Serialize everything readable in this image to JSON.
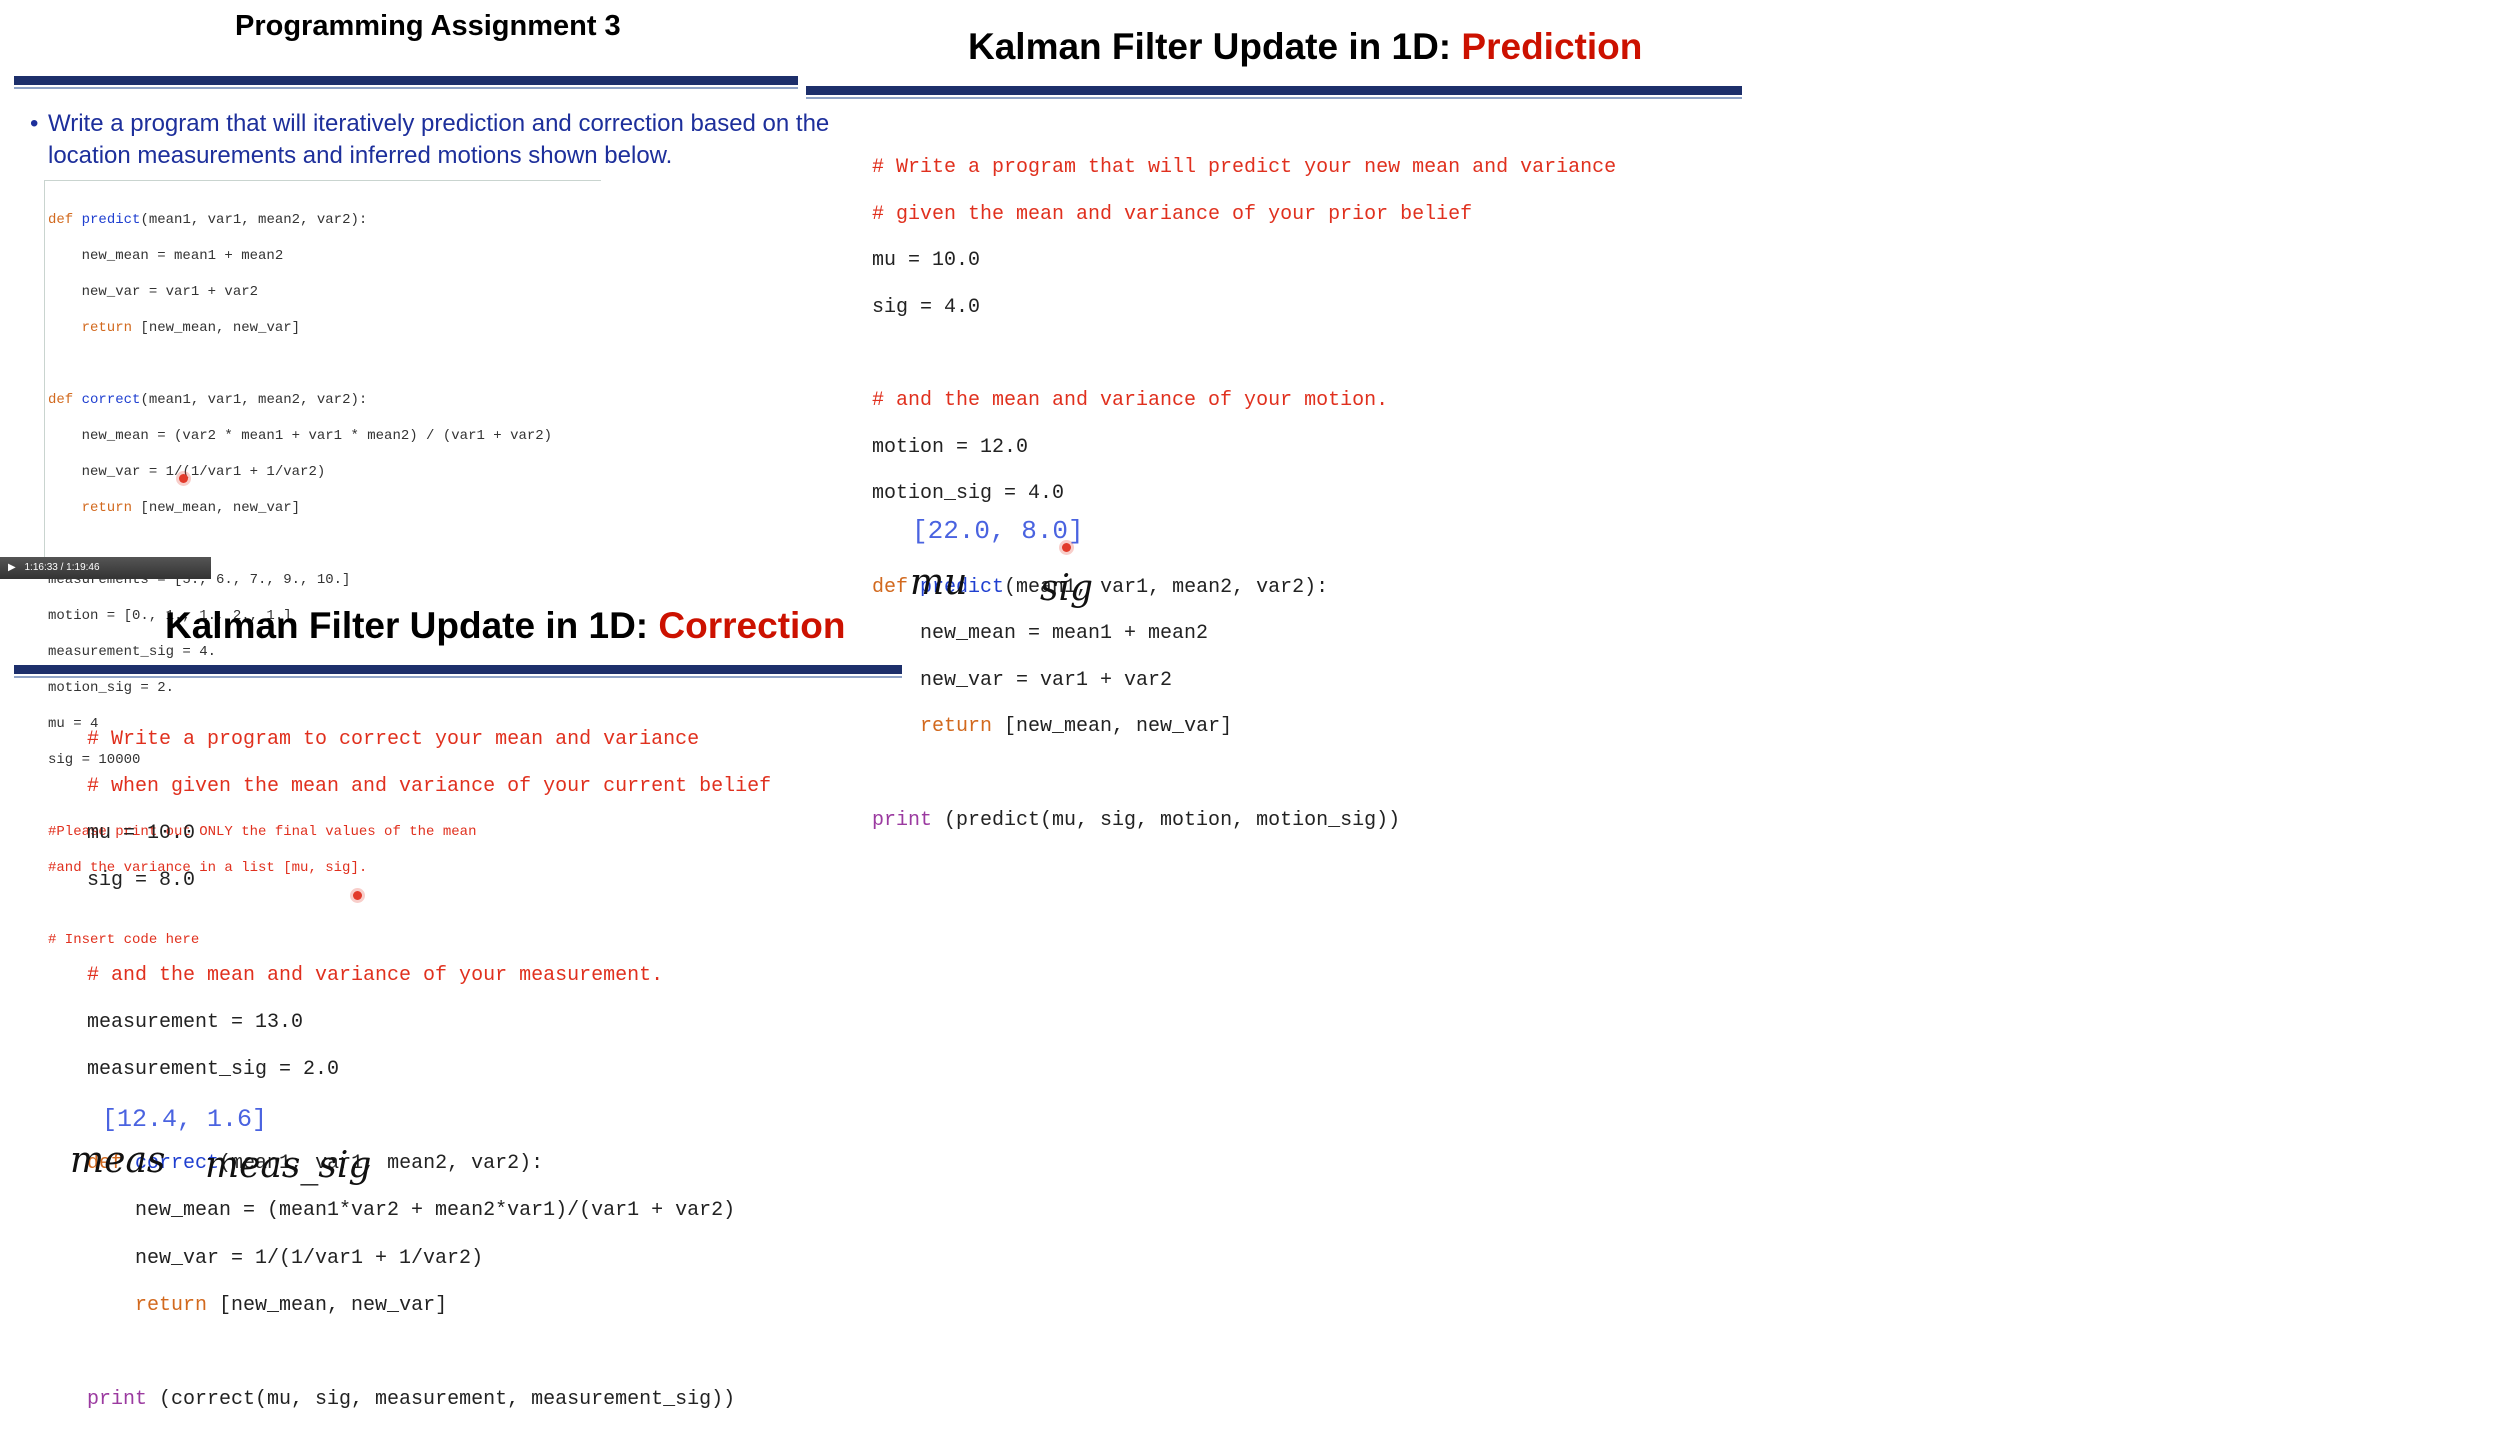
{
  "assignment": {
    "title": "Programming Assignment 3",
    "bullet": "•",
    "text_line1": "Write a program that will iteratively prediction and correction based on the",
    "text_line2": "location measurements and inferred motions shown below.",
    "code": {
      "l1_kw": "def",
      "l1_fn": "predict",
      "l1_rest": "(mean1, var1, mean2, var2):",
      "l2": "    new_mean = mean1 + mean2",
      "l3": "    new_var = var1 + var2",
      "l4_kw": "    return",
      "l4_rest": " [new_mean, new_var]",
      "l6_kw": "def",
      "l6_fn": "correct",
      "l6_rest": "(mean1, var1, mean2, var2):",
      "l7": "    new_mean = (var2 * mean1 + var1 * mean2) / (var1 + var2)",
      "l8": "    new_var = 1/(1/var1 + 1/var2)",
      "l9_kw": "    return",
      "l9_rest": " [new_mean, new_var]",
      "l11": "measurements = [5., 6., 7., 9., 10.]",
      "l12": "motion = [0., 1., 1., 2., 1.]",
      "l13": "measurement_sig = 4.",
      "l14": "motion_sig = 2.",
      "l15": "mu = 4",
      "l16": "sig = 10000",
      "l18": "#Please print out ONLY the final values of the mean",
      "l19": "#and the variance in a list [mu, sig].",
      "l21": "# Insert code here"
    },
    "video_time": "1:16:33 / 1:19:46"
  },
  "prediction": {
    "title_prefix": "Kalman Filter Update in 1D: ",
    "title_highlight": "Prediction",
    "code": {
      "c1": "# Write a program that will predict your new mean and variance",
      "c2": "# given the mean and variance of your prior belief",
      "l3": "mu = 10.0",
      "l4": "sig = 4.0",
      "c6": "# and the mean and variance of your motion.",
      "l7": "motion = 12.0",
      "l8": "motion_sig = 4.0",
      "l10_kw": "def",
      "l10_fn": "predict",
      "l10_rest": "(mean1, var1, mean2, var2):",
      "l11": "    new_mean = mean1 + mean2",
      "l12": "    new_var = var1 + var2",
      "l13_kw": "    return",
      "l13_rest": " [new_mean, new_var]",
      "l15_kw": "print",
      "l15_rest": " (predict(mu, sig, motion, motion_sig))"
    },
    "output": "[22.0, 8.0]",
    "hand_mu": "mu",
    "hand_sig": "sig"
  },
  "correction": {
    "title_prefix": "Kalman Filter Update in 1D: ",
    "title_highlight": "Correction",
    "code": {
      "c1": "# Write a program to correct your mean and variance",
      "c2": "# when given the mean and variance of your current belief",
      "l3": "mu = 10.0",
      "l4": "sig = 8.0",
      "c6": "# and the mean and variance of your measurement.",
      "l7": "measurement = 13.0",
      "l8": "measurement_sig = 2.0",
      "l10_kw": "def",
      "l10_fn": "correct",
      "l10_rest": "(mean1, var1, mean2, var2):",
      "l11": "    new_mean = (mean1*var2 + mean2*var1)/(var1 + var2)",
      "l12": "    new_var = 1/(1/var1 + 1/var2)",
      "l13_kw": "    return",
      "l13_rest": " [new_mean, new_var]",
      "l15_kw": "print",
      "l15_rest": " (correct(mu, sig, measurement, measurement_sig))"
    },
    "output": "[12.4, 1.6]",
    "hand_meas": "meas",
    "hand_meas_sig": "meas_sig"
  }
}
